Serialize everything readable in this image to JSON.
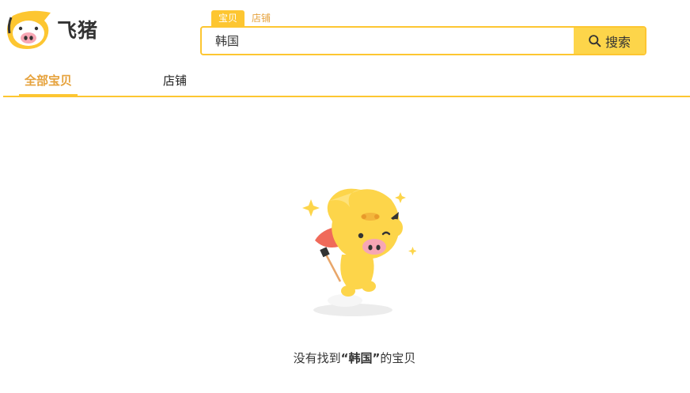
{
  "logo": {
    "text": "飞猪",
    "icon": "pig-logo-icon"
  },
  "search": {
    "types": [
      "宝贝",
      "店铺"
    ],
    "active_type": "宝贝",
    "query": "韩国",
    "button_label": "搜索",
    "button_icon": "search-icon"
  },
  "tabs": {
    "all_items": "全部宝贝",
    "shops": "店铺"
  },
  "empty": {
    "prefix": "没有找到",
    "quote_open": "“",
    "keyword": "韩国",
    "quote_close": "”",
    "suffix": "的宝贝",
    "illustration": "flying-pig-mascot"
  },
  "colors": {
    "accent": "#fdc631",
    "accent_text": "#e6a23c",
    "button": "#fdd54a"
  }
}
